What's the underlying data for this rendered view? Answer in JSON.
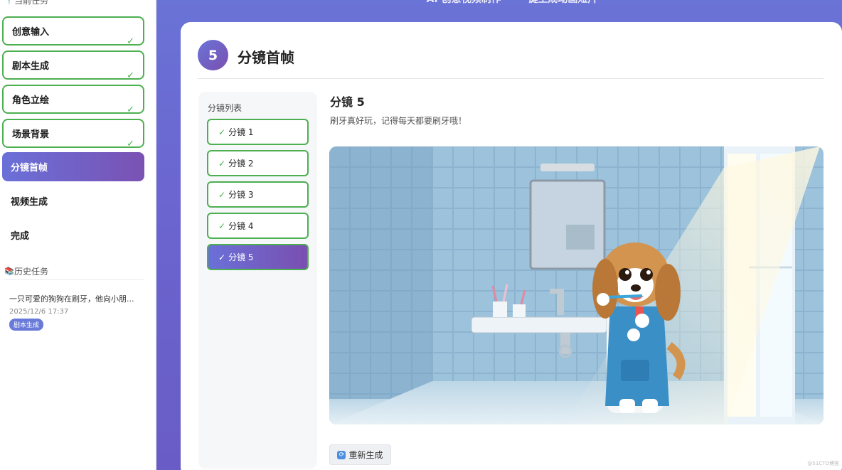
{
  "sidebar": {
    "current_section": {
      "icon": "pin-icon",
      "label": "当前任务"
    },
    "steps": [
      {
        "label": "创意输入",
        "status": "done"
      },
      {
        "label": "剧本生成",
        "status": "done"
      },
      {
        "label": "角色立绘",
        "status": "done"
      },
      {
        "label": "场景背景",
        "status": "done"
      },
      {
        "label": "分镜首帧",
        "status": "active"
      },
      {
        "label": "视频生成",
        "status": "pending"
      },
      {
        "label": "完成",
        "status": "pending"
      }
    ],
    "check_mark": "✓",
    "history_section": {
      "icon": "books-icon",
      "label": "历史任务"
    },
    "history": [
      {
        "title": "一只可爱的狗狗在刷牙，他向小朋...",
        "date": "2025/12/6 17:37",
        "badge": "剧本生成"
      }
    ]
  },
  "header": {
    "title": "AI 创意视频制作 — 一键生成动画短片"
  },
  "main": {
    "step_number": "5",
    "step_title": "分镜首帧",
    "shot_list": {
      "title": "分镜列表",
      "items": [
        {
          "label": "分镜 1",
          "done": true,
          "active": false
        },
        {
          "label": "分镜 2",
          "done": true,
          "active": false
        },
        {
          "label": "分镜 3",
          "done": true,
          "active": false
        },
        {
          "label": "分镜 4",
          "done": true,
          "active": false
        },
        {
          "label": "分镜 5",
          "done": true,
          "active": true
        }
      ]
    },
    "detail": {
      "title": "分镜 5",
      "description": "刷牙真好玩，记得每天都要刷牙哦！",
      "image_alt": "卡通小狗穿着蓝色围裙在浴室里刷牙"
    },
    "regenerate_label": "重新生成",
    "regenerate_icon": "refresh-icon"
  },
  "watermark": "@51CTO博客",
  "colors": {
    "accent_start": "#6a74d8",
    "accent_end": "#7a4fb0",
    "done_green": "#4caf50",
    "background_purple": "#6a6ad2"
  }
}
